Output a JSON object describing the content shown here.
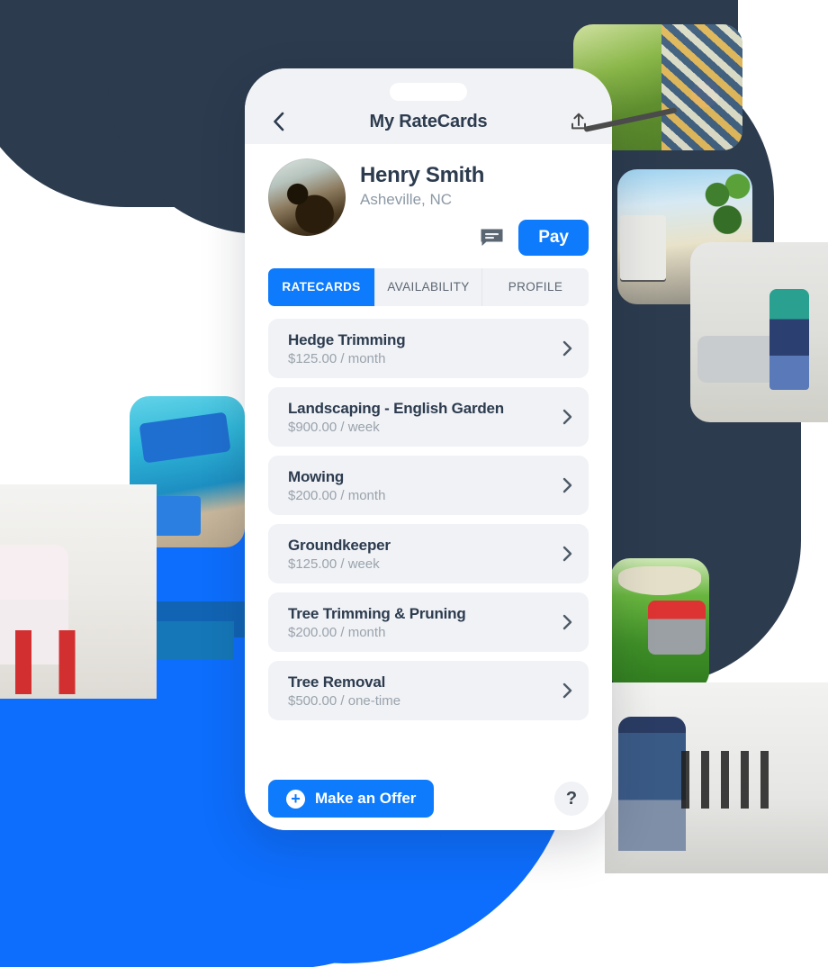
{
  "colors": {
    "accent_blue": "#0D7BFB",
    "blob_blue": "#0D6EFD",
    "navy": "#2C3B4E",
    "card_bg": "#F0F2F6",
    "muted_text": "#9AA3AC"
  },
  "phone": {
    "navbar": {
      "back_icon": "chevron-left-icon",
      "title": "My RateCards",
      "share_icon": "upload-share-icon"
    },
    "profile": {
      "avatar_icon": "user-avatar",
      "name": "Henry Smith",
      "location": "Asheville, NC",
      "message_icon": "message-bubble-icon",
      "pay_label": "Pay"
    },
    "tabs": [
      {
        "label": "RATECARDS",
        "active": true
      },
      {
        "label": "AVAILABILITY",
        "active": false
      },
      {
        "label": "PROFILE",
        "active": false
      }
    ],
    "ratecards": [
      {
        "title": "Hedge Trimming",
        "price": "$125.00 / month"
      },
      {
        "title": "Landscaping - English Garden",
        "price": "$900.00 / week"
      },
      {
        "title": "Mowing",
        "price": "$200.00 / month"
      },
      {
        "title": "Groundkeeper",
        "price": "$125.00 / week"
      },
      {
        "title": "Tree Trimming & Pruning",
        "price": "$200.00 / month"
      },
      {
        "title": "Tree Removal",
        "price": "$500.00 / one-time"
      }
    ],
    "actions": {
      "offer_label": "Make an Offer",
      "offer_plus_icon": "plus-circle-icon",
      "help_label": "?"
    }
  },
  "background": {
    "photos": [
      {
        "name": "hedge-trimming-photo"
      },
      {
        "name": "moving-truck-photo"
      },
      {
        "name": "home-cleaning-photo"
      },
      {
        "name": "lawn-mower-photo"
      },
      {
        "name": "plumber-photo"
      },
      {
        "name": "pool-cleaning-photo"
      },
      {
        "name": "house-painter-photo"
      }
    ]
  }
}
